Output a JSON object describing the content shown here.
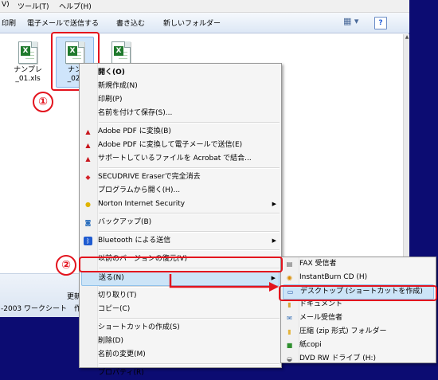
{
  "menubar": {
    "items": [
      "V)",
      "ツール(T)",
      "ヘルプ(H)"
    ]
  },
  "toolbar": {
    "left_cut": "印刷",
    "email": "電子メールで送信する",
    "burn": "書き込む",
    "new_folder": "新しいフォルダー"
  },
  "files": [
    {
      "name_line1": "ナンプレ",
      "name_line2": "_01.xls"
    },
    {
      "name_line1": "ナン",
      "name_line2": "_02."
    },
    {
      "name_line1": "",
      "name_line2": ""
    }
  ],
  "details": {
    "line1": "更新",
    "line2": "-2003 ワークシート",
    "line3": "作"
  },
  "markers": {
    "one": "①",
    "two": "②"
  },
  "context_menu": {
    "items": [
      {
        "label": "開く(O)",
        "bold": true
      },
      {
        "label": "新規作成(N)"
      },
      {
        "label": "印刷(P)"
      },
      {
        "label": "名前を付けて保存(S)..."
      },
      {
        "sep": true
      },
      {
        "label": "Adobe PDF に変換(B)",
        "icon": "pdf"
      },
      {
        "label": "Adobe PDF に変換して電子メールで送信(E)",
        "icon": "pdf"
      },
      {
        "label": "サポートしているファイルを Acrobat で結合...",
        "icon": "pdf"
      },
      {
        "sep": true
      },
      {
        "label": "SECUDRIVE Eraserで完全消去",
        "icon": "secu"
      },
      {
        "label": "プログラムから開く(H)..."
      },
      {
        "label": "Norton Internet Security",
        "icon": "norton",
        "submenu": true
      },
      {
        "sep": true
      },
      {
        "label": "バックアップ(B)",
        "icon": "backup"
      },
      {
        "sep": true
      },
      {
        "label": "Bluetooth による送信",
        "icon": "bluetooth",
        "submenu": true
      },
      {
        "sep": true
      },
      {
        "label": "以前のバージョンの復元(V)"
      },
      {
        "sep": true
      },
      {
        "label": "送る(N)",
        "submenu": true,
        "highlight": true
      },
      {
        "sep": true
      },
      {
        "label": "切り取り(T)"
      },
      {
        "label": "コピー(C)"
      },
      {
        "sep": true
      },
      {
        "label": "ショートカットの作成(S)"
      },
      {
        "label": "削除(D)"
      },
      {
        "label": "名前の変更(M)"
      },
      {
        "sep": true
      },
      {
        "label": "プロパティ(R)"
      }
    ]
  },
  "sendto_menu": {
    "items": [
      {
        "label": "FAX 受信者",
        "icon": "fax"
      },
      {
        "label": "InstantBurn CD (H)",
        "icon": "cd"
      },
      {
        "label": "デスクトップ (ショートカットを作成)",
        "icon": "desktop",
        "highlight": true
      },
      {
        "label": "ドキュメント",
        "icon": "docs"
      },
      {
        "label": "メール受信者",
        "icon": "mail"
      },
      {
        "label": "圧縮 (zip 形式) フォルダー",
        "icon": "zip"
      },
      {
        "label": "紙copi",
        "icon": "kami"
      },
      {
        "label": "DVD RW ドライブ (H:)",
        "icon": "dvd"
      }
    ]
  },
  "colors": {
    "annotation_red": "#e3141e",
    "desktop_bg": "#0c0c72"
  }
}
